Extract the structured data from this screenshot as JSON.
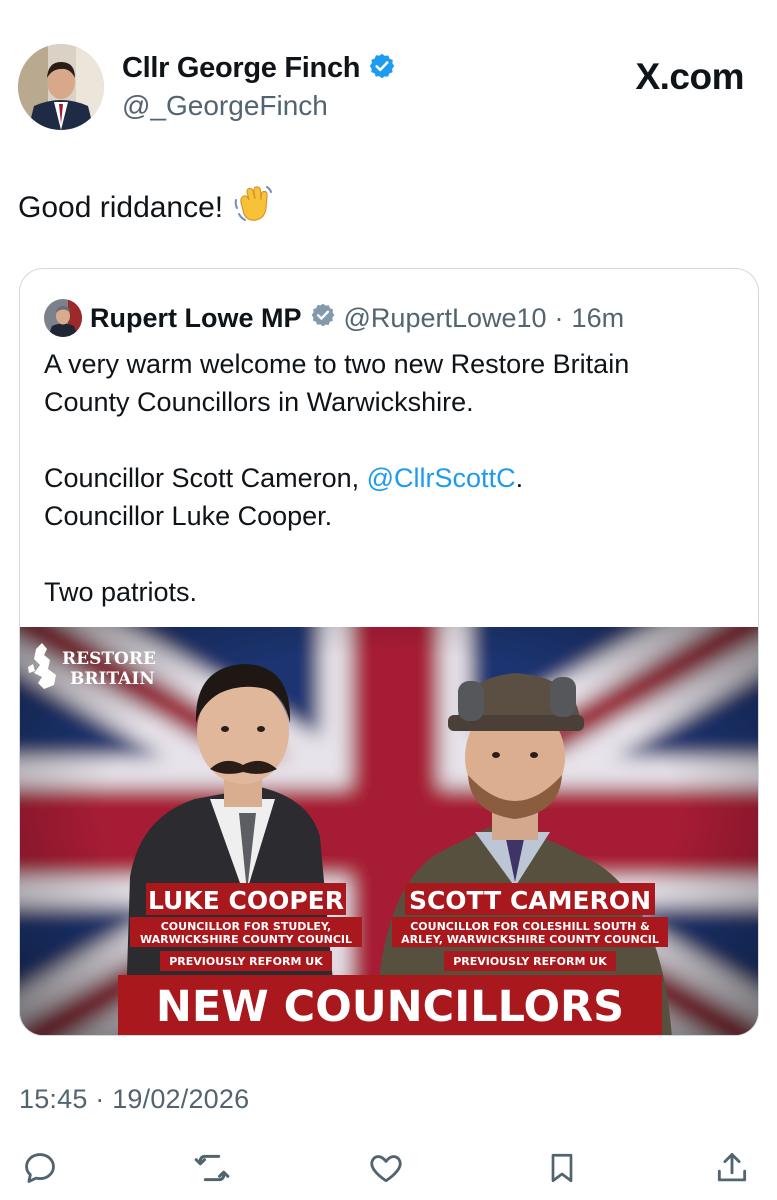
{
  "author": {
    "display_name": "Cllr George Finch",
    "handle": "@_GeorgeFinch",
    "verified": true,
    "verified_color": "#1d9bf0"
  },
  "brand": "X.com",
  "tweet": {
    "text": "Good riddance!",
    "emoji": "waving-hand-emoji"
  },
  "quoted": {
    "display_name": "Rupert Lowe MP",
    "verified": true,
    "verified_color": "#829aab",
    "handle": "@RupertLowe10",
    "separator": "·",
    "time": "16m",
    "line1": "A very warm welcome to two new Restore Britain",
    "line2": "County Councillors in Warwickshire.",
    "line3_prefix": "Councillor Scott Cameron, ",
    "line3_mention": "@CllrScottC",
    "line3_suffix": ".",
    "line4": "Councillor Luke Cooper.",
    "line5": "Two patriots.",
    "mention_color": "#1d9bf0",
    "image": {
      "logo_line1": "RESTORE",
      "logo_line2": "BRITAIN",
      "left_person": {
        "name": "LUKE COOPER",
        "role_line1": "COUNCILLOR FOR STUDLEY,",
        "role_line2": "WARWICKSHIRE COUNTY COUNCIL",
        "note": "PREVIOUSLY REFORM UK"
      },
      "right_person": {
        "name": "SCOTT CAMERON",
        "role_line1": "COUNCILLOR FOR COLESHILL SOUTH &",
        "role_line2": "ARLEY, WARWICKSHIRE COUNTY COUNCIL",
        "note": "PREVIOUSLY REFORM UK"
      },
      "banner": "NEW COUNCILLORS",
      "accent": "#a8181c"
    }
  },
  "meta": {
    "time": "15:45",
    "separator": "·",
    "date": "19/02/2026"
  },
  "actions": [
    "reply-icon",
    "repost-icon",
    "like-icon",
    "bookmark-icon",
    "share-icon"
  ],
  "colors": {
    "text": "#0f1419",
    "secondary": "#536471",
    "border": "#cfd9de"
  }
}
